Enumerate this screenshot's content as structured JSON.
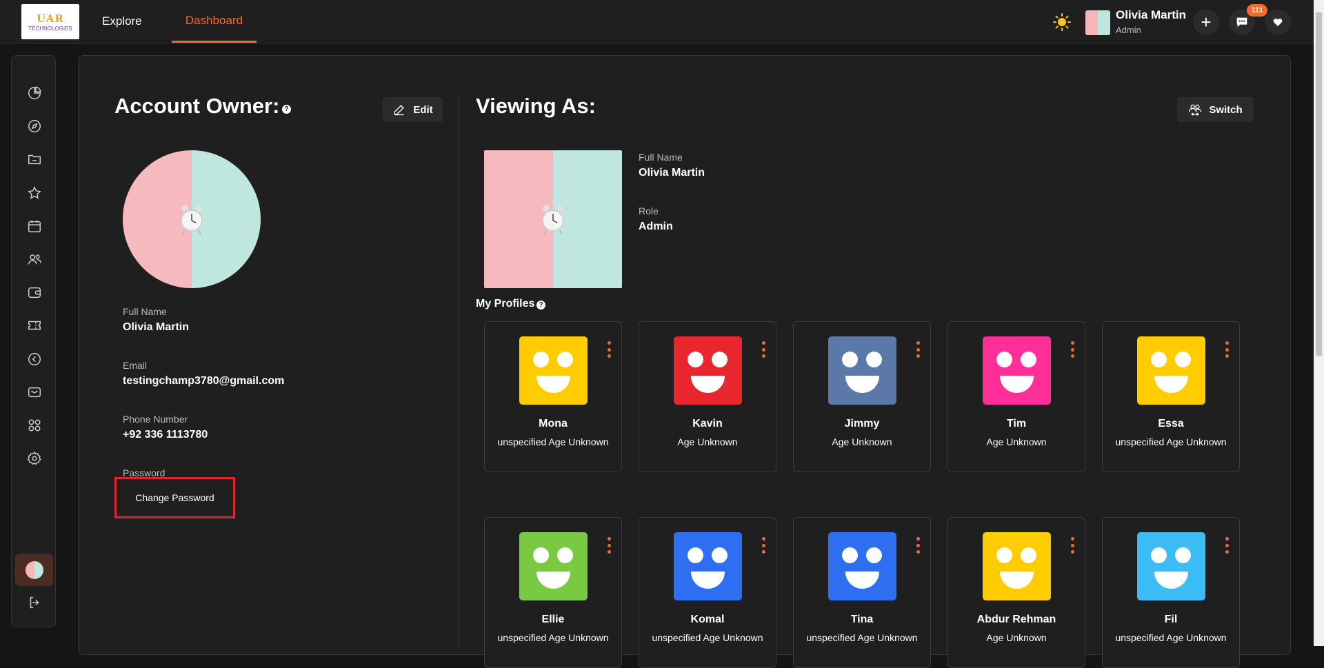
{
  "header": {
    "logo_line1": "UAR",
    "logo_line2": "TECHNOLOGIES",
    "nav": [
      {
        "label": "Explore",
        "active": false
      },
      {
        "label": "Dashboard",
        "active": true
      }
    ],
    "user_name": "Olivia Martin",
    "user_role": "Admin",
    "add_label": "+",
    "notification_count": "111",
    "accent_color": "#f26a2e"
  },
  "sidebar": {
    "icons": [
      "chart-pie-icon",
      "compass-icon",
      "folder-icon",
      "star-icon",
      "calendar-icon",
      "users-icon",
      "wallet-icon",
      "ticket-icon",
      "back-circle-icon",
      "mail-icon",
      "apps-grid-icon",
      "settings-gear-icon"
    ],
    "logout_icon": "logout-icon"
  },
  "account_owner": {
    "title": "Account Owner:",
    "help": "?",
    "edit_label": "Edit",
    "full_name_label": "Full Name",
    "full_name": "Olivia Martin",
    "email_label": "Email",
    "email": "testingchamp3780@gmail.com",
    "phone_label": "Phone Number",
    "phone": "+92 336 1113780",
    "password_label": "Password",
    "change_password_label": "Change Password"
  },
  "viewing_as": {
    "title": "Viewing As:",
    "switch_label": "Switch",
    "full_name_label": "Full Name",
    "full_name": "Olivia Martin",
    "role_label": "Role",
    "role": "Admin"
  },
  "profiles": {
    "title": "My Profiles",
    "help": "?",
    "items": [
      {
        "name": "Mona",
        "info": "unspecified Age Unknown",
        "color": "#ffcc00"
      },
      {
        "name": "Kavin",
        "info": "Age Unknown",
        "color": "#e8262e"
      },
      {
        "name": "Jimmy",
        "info": "Age Unknown",
        "color": "#5c78a8"
      },
      {
        "name": "Tim",
        "info": "Age Unknown",
        "color": "#ff2e99"
      },
      {
        "name": "Essa",
        "info": "unspecified Age Unknown",
        "color": "#ffcc00"
      },
      {
        "name": "Ellie",
        "info": "unspecified Age Unknown",
        "color": "#7ac943"
      },
      {
        "name": "Komal",
        "info": "unspecified Age Unknown",
        "color": "#2d6ff0"
      },
      {
        "name": "Tina",
        "info": "unspecified Age Unknown",
        "color": "#2d6ff0"
      },
      {
        "name": "Abdur Rehman",
        "info": "Age Unknown",
        "color": "#ffcc00"
      },
      {
        "name": "Fil",
        "info": "unspecified Age Unknown",
        "color": "#3cbcf4"
      }
    ]
  }
}
